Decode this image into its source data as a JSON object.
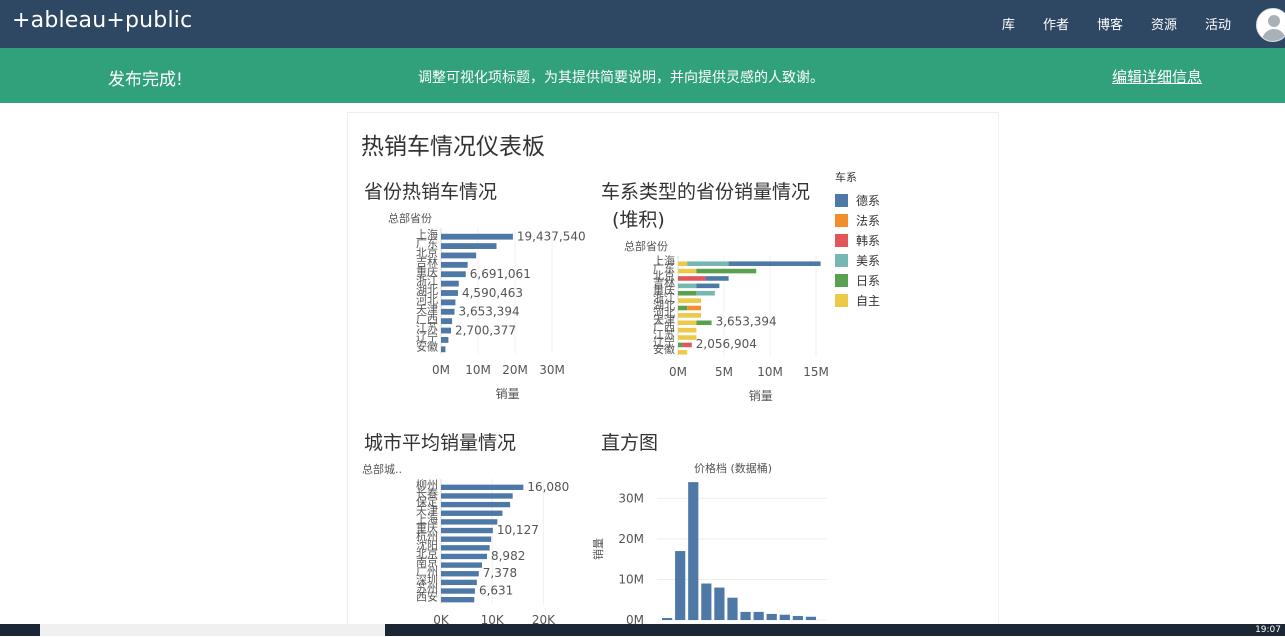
{
  "nav": {
    "logo": "+ableau+public",
    "links": [
      "库",
      "作者",
      "博客",
      "资源",
      "活动"
    ]
  },
  "banner": {
    "done": "发布完成!",
    "message": "调整可视化项标题，为其提供简要说明，并向提供灵感的人致谢。",
    "edit_link": "编辑详细信息"
  },
  "dashboard": {
    "title": "热销车情况仪表板",
    "panels": {
      "p1": "省份热销车情况",
      "p2_line1": "车系类型的省份销量情况",
      "p2_line2": "(堆积)",
      "p3": "城市平均销量情况",
      "p4": "直方图"
    }
  },
  "legend": {
    "title": "车系",
    "items": [
      {
        "label": "德系",
        "color": "#4e79a7"
      },
      {
        "label": "法系",
        "color": "#f28e2b"
      },
      {
        "label": "韩系",
        "color": "#e15759"
      },
      {
        "label": "美系",
        "color": "#76b7b2"
      },
      {
        "label": "日系",
        "color": "#59a14f"
      },
      {
        "label": "自主",
        "color": "#edc948"
      }
    ]
  },
  "taskbar": {
    "time": "19:07"
  },
  "chart_data": [
    {
      "type": "bar",
      "title": "省份热销车情况",
      "dim_label": "总部省份",
      "xlabel": "销量",
      "categories": [
        "上海",
        "广东",
        "北京",
        "吉林",
        "重庆",
        "浙江",
        "湖北",
        "河北",
        "天津",
        "广西",
        "江苏",
        "辽宁",
        "安徽"
      ],
      "values": [
        19437540,
        15000000,
        9500000,
        7200000,
        6691061,
        4800000,
        4590463,
        3900000,
        3653394,
        3000000,
        2700377,
        2000000,
        1200000
      ],
      "data_labels": {
        "0": "19,437,540",
        "4": "6,691,061",
        "6": "4,590,463",
        "8": "3,653,394",
        "10": "2,700,377"
      },
      "xticks": [
        "0M",
        "10M",
        "20M",
        "30M"
      ],
      "xlim": [
        0,
        40000000
      ],
      "color": "#4e79a7"
    },
    {
      "type": "bar",
      "stacked": true,
      "title": "车系类型的省份销量情况 (堆积)",
      "dim_label": "总部省份",
      "xlabel": "销量",
      "categories": [
        "上海",
        "广东",
        "北京",
        "吉林",
        "重庆",
        "浙江",
        "湖北",
        "河北",
        "天津",
        "广西",
        "江苏",
        "辽宁",
        "安徽"
      ],
      "series": [
        {
          "name": "自主",
          "color": "#edc948",
          "values": [
            1000000,
            2000000,
            0,
            0,
            0,
            2500000,
            0,
            2500000,
            2000000,
            2000000,
            2000000,
            0,
            1000000
          ]
        },
        {
          "name": "日系",
          "color": "#59a14f",
          "values": [
            0,
            6500000,
            0,
            0,
            2000000,
            0,
            1000000,
            0,
            1650000,
            0,
            0,
            500000,
            0
          ]
        },
        {
          "name": "美系",
          "color": "#76b7b2",
          "values": [
            4500000,
            0,
            0,
            2000000,
            2000000,
            0,
            0,
            0,
            0,
            0,
            0,
            0,
            0
          ]
        },
        {
          "name": "韩系",
          "color": "#e15759",
          "values": [
            0,
            0,
            3000000,
            0,
            0,
            0,
            0,
            0,
            0,
            0,
            0,
            1000000,
            0
          ]
        },
        {
          "name": "法系",
          "color": "#f28e2b",
          "values": [
            0,
            0,
            0,
            0,
            0,
            0,
            1500000,
            0,
            0,
            0,
            0,
            0,
            0
          ]
        },
        {
          "name": "德系",
          "color": "#4e79a7",
          "values": [
            10000000,
            0,
            2500000,
            2500000,
            0,
            0,
            0,
            0,
            0,
            0,
            0,
            0,
            0
          ]
        }
      ],
      "data_labels": {
        "8": "3,653,394",
        "11": "2,056,904"
      },
      "xticks": [
        "0M",
        "5M",
        "10M",
        "15M"
      ],
      "xlim": [
        0,
        20000000
      ]
    },
    {
      "type": "bar",
      "title": "城市平均销量情况",
      "dim_label": "总部城..",
      "xlabel": "",
      "categories": [
        "柳州",
        "长春",
        "保定",
        "天津",
        "上海",
        "重庆",
        "杭州",
        "沈阳",
        "北京",
        "南京",
        "广州",
        "深圳",
        "苏州",
        "西安"
      ],
      "values": [
        16080,
        14000,
        13500,
        12000,
        11000,
        10127,
        9800,
        9500,
        8982,
        8000,
        7378,
        7000,
        6631,
        6500
      ],
      "data_labels": {
        "0": "16,080",
        "5": "10,127",
        "8": "8,982",
        "10": "7,378",
        "12": "6,631"
      },
      "xticks": [
        "0K",
        "10K",
        "20K"
      ],
      "xlim": [
        0,
        25000
      ],
      "color": "#4e79a7"
    },
    {
      "type": "bar",
      "title": "直方图",
      "subtitle": "价格档 (数据桶)",
      "ylabel": "销量",
      "values": [
        500000,
        17000000,
        34000000,
        9000000,
        8000000,
        5500000,
        2000000,
        2000000,
        1500000,
        1300000,
        1000000,
        800000
      ],
      "yticks": [
        "0M",
        "10M",
        "20M",
        "30M"
      ],
      "ylim": [
        0,
        36000000
      ],
      "color": "#4e79a7"
    }
  ]
}
